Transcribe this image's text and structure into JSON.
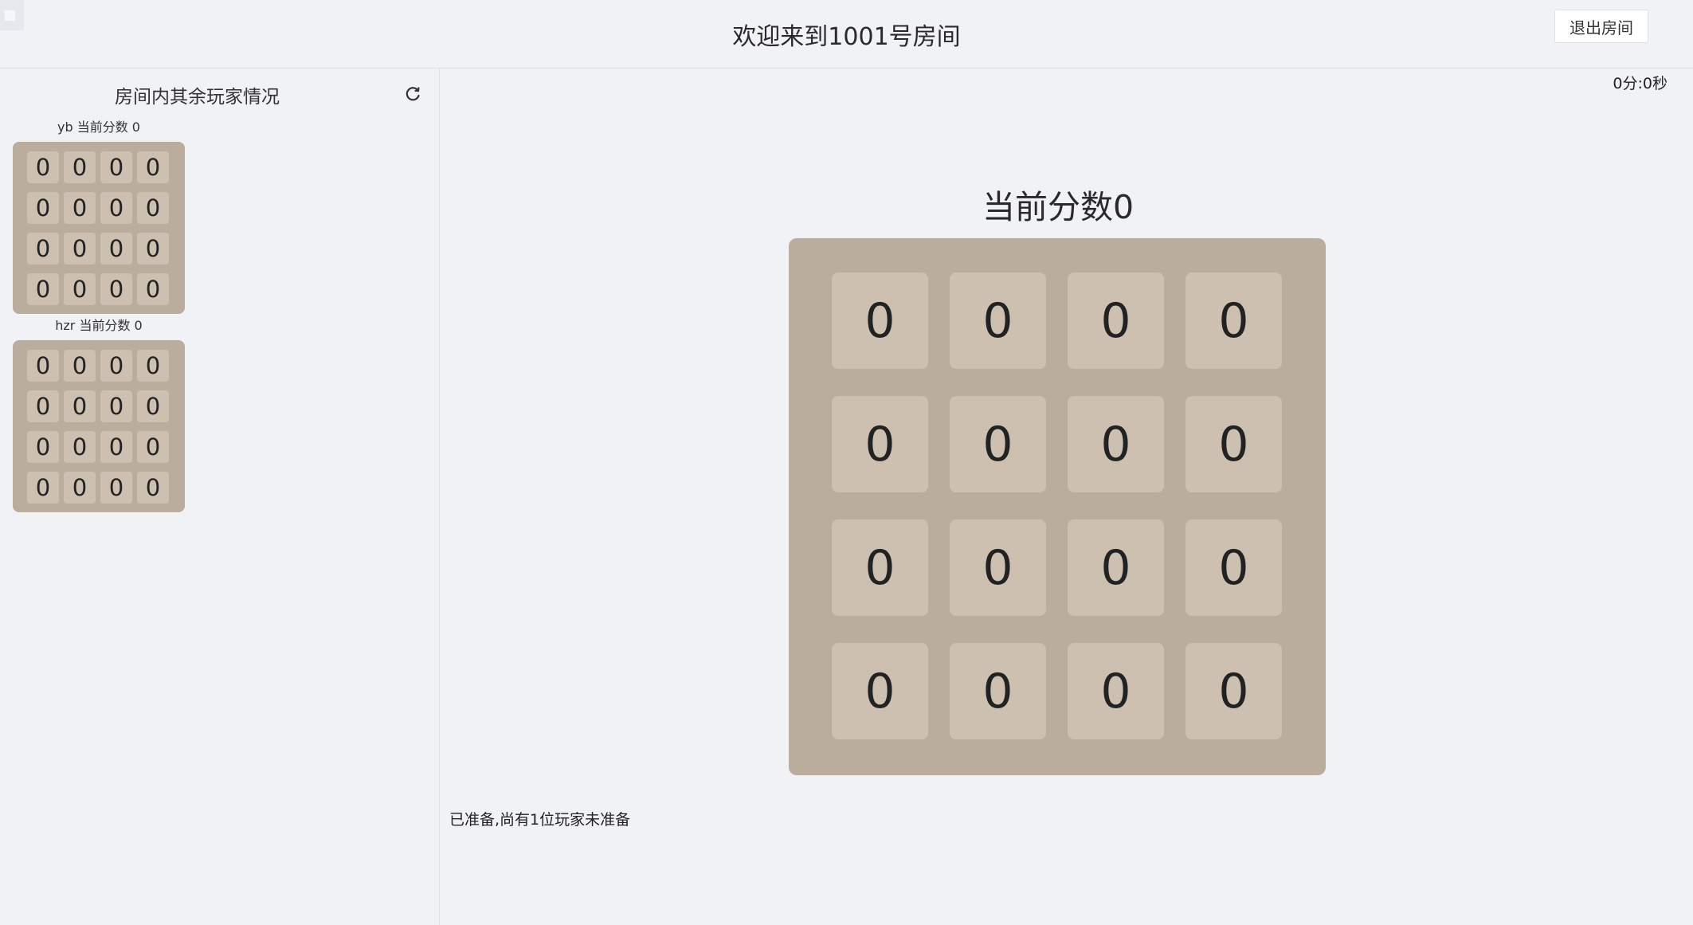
{
  "header": {
    "title": "欢迎来到1001号房间",
    "exit_label": "退出房间"
  },
  "sidebar": {
    "title": "房间内其余玩家情况",
    "refresh_icon": "refresh-icon",
    "players": [
      {
        "label": "yb 当前分数 0",
        "tiles": [
          "0",
          "0",
          "0",
          "0",
          "0",
          "0",
          "0",
          "0",
          "0",
          "0",
          "0",
          "0",
          "0",
          "0",
          "0",
          "0"
        ]
      },
      {
        "label": "hzr 当前分数 0",
        "tiles": [
          "0",
          "0",
          "0",
          "0",
          "0",
          "0",
          "0",
          "0",
          "0",
          "0",
          "0",
          "0",
          "0",
          "0",
          "0",
          "0"
        ]
      }
    ]
  },
  "main": {
    "timer": "0分:0秒",
    "score_title": "当前分数0",
    "tiles": [
      "0",
      "0",
      "0",
      "0",
      "0",
      "0",
      "0",
      "0",
      "0",
      "0",
      "0",
      "0",
      "0",
      "0",
      "0",
      "0"
    ],
    "status": "已准备,尚有1位玩家未准备"
  },
  "colors": {
    "board": "#bbad9e",
    "tile": "#cdc0b1",
    "background": "#f1f2f6"
  }
}
